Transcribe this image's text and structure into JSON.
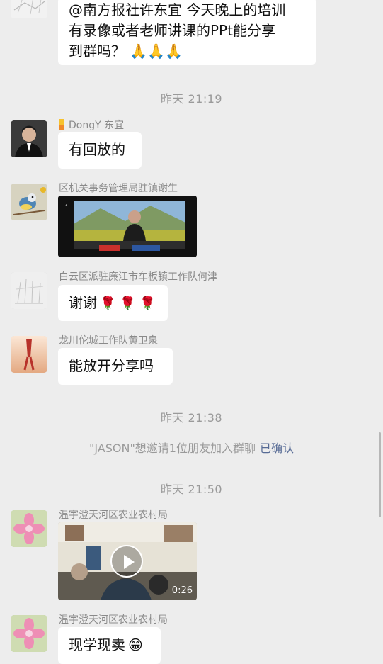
{
  "messages": {
    "m1_text_line1": "@南方报社许东宜 今天晚上的培训",
    "m1_text_line2": "有录像或者老师讲课的PPt能分享",
    "m1_text_line3": "到群吗？",
    "m1_emoji": "🙏🙏🙏",
    "t1": "昨天 21:19",
    "m2_sender": "DongY 东宜",
    "m2_text": "有回放的",
    "m3_sender": "区机关事务管理局驻镇谢生",
    "m4_sender": "白云区派驻廉江市车板镇工作队何津",
    "m4_text": "谢谢",
    "m4_roses": "🌹 🌹 🌹",
    "m5_sender": "龙川佗城工作队黄卫泉",
    "m5_text": "能放开分享吗",
    "t2": "昨天 21:38",
    "sys_text": "\"JASON\"想邀请1位朋友加入群聊",
    "sys_link": "已确认",
    "t3": "昨天 21:50",
    "m6_sender": "温宇澄天河区农业农村局",
    "m6_video_duration": "0:26",
    "m7_sender": "温宇澄天河区农业农村局",
    "m7_text": "现学现卖",
    "m7_emoji": "😁"
  },
  "colors": {
    "background": "#ededed",
    "bubble": "#ffffff",
    "link": "#576b95",
    "meta_text": "#9a9a9a"
  }
}
